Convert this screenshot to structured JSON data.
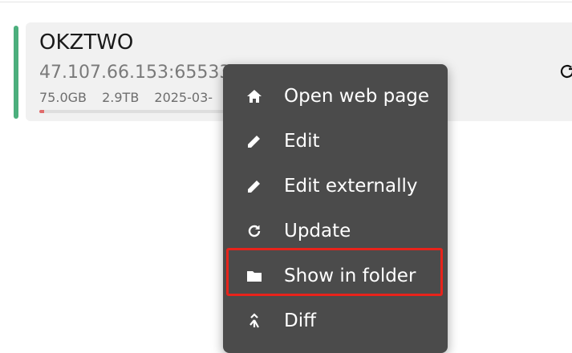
{
  "profile": {
    "name": "OKZTWO",
    "url": "47.107.66.153:65533",
    "used": "75.0GB",
    "total": "2.9TB",
    "date_fragment": "2025-03-",
    "usage_fraction": 0.025
  },
  "context_menu": {
    "items": [
      {
        "label": "Open web page",
        "icon": "home-icon"
      },
      {
        "label": "Edit",
        "icon": "pencil-icon"
      },
      {
        "label": "Edit externally",
        "icon": "pencil-icon"
      },
      {
        "label": "Update",
        "icon": "refresh-icon"
      },
      {
        "label": "Show in folder",
        "icon": "folder-icon"
      },
      {
        "label": "Diff",
        "icon": "merge-icon"
      }
    ]
  },
  "colors": {
    "accent": "#4caf7d",
    "menu_bg": "#4b4b4b",
    "highlight": "#e8231b",
    "usage": "#e06b6b"
  }
}
